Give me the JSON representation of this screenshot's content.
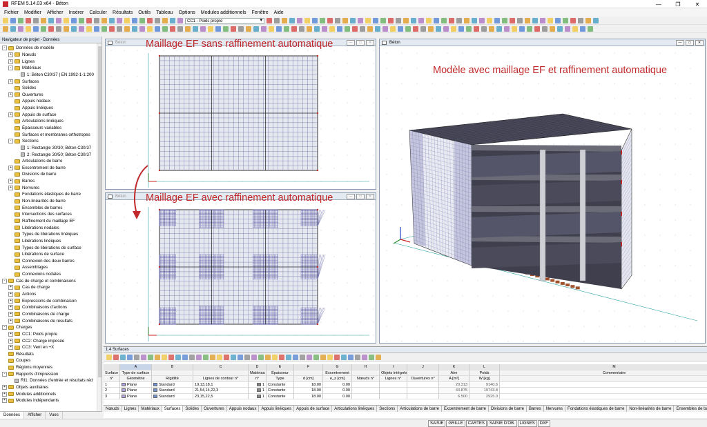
{
  "window": {
    "title": "RFEM 5.14.03 x64 - Béton",
    "min": "—",
    "max": "❐",
    "close": "✕"
  },
  "menu": [
    "Fichier",
    "Modifier",
    "Afficher",
    "Insérer",
    "Calculer",
    "Résultats",
    "Outils",
    "Tableau",
    "Options",
    "Modules additionnels",
    "Fenêtre",
    "Aide"
  ],
  "toolbar": {
    "loadcase": "CC1 - Poids propre"
  },
  "navigator": {
    "title": "Navigateur de projet - Données",
    "items": [
      {
        "label": "Données de modèle",
        "level": 0,
        "exp": "-",
        "icon": "fold"
      },
      {
        "label": "Nœuds",
        "level": 1,
        "exp": "+",
        "icon": "fold"
      },
      {
        "label": "Lignes",
        "level": 1,
        "exp": "+",
        "icon": "fold"
      },
      {
        "label": "Matériaux",
        "level": 1,
        "exp": "-",
        "icon": "fold"
      },
      {
        "label": "1: Béton C30/37 | EN 1992-1-1:200",
        "level": 2,
        "exp": "",
        "icon": "item"
      },
      {
        "label": "Surfaces",
        "level": 1,
        "exp": "+",
        "icon": "fold"
      },
      {
        "label": "Solides",
        "level": 1,
        "exp": "",
        "icon": "fold"
      },
      {
        "label": "Ouvertures",
        "level": 1,
        "exp": "+",
        "icon": "fold"
      },
      {
        "label": "Appuis nodaux",
        "level": 1,
        "exp": "",
        "icon": "fold"
      },
      {
        "label": "Appuis linéiques",
        "level": 1,
        "exp": "",
        "icon": "fold"
      },
      {
        "label": "Appuis de surface",
        "level": 1,
        "exp": "+",
        "icon": "fold"
      },
      {
        "label": "Articulations linéiques",
        "level": 1,
        "exp": "",
        "icon": "fold"
      },
      {
        "label": "Épaisseurs variables",
        "level": 1,
        "exp": "",
        "icon": "fold"
      },
      {
        "label": "Surfaces et membranes orthotropes",
        "level": 1,
        "exp": "",
        "icon": "fold"
      },
      {
        "label": "Sections",
        "level": 1,
        "exp": "-",
        "icon": "fold"
      },
      {
        "label": "1: Rectangle 30/30; Béton C30/37",
        "level": 2,
        "exp": "",
        "icon": "item"
      },
      {
        "label": "2: Rectangle 30/50; Béton C30/37",
        "level": 2,
        "exp": "",
        "icon": "item"
      },
      {
        "label": "Articulations de barre",
        "level": 1,
        "exp": "",
        "icon": "fold"
      },
      {
        "label": "Excentrement de barre",
        "level": 1,
        "exp": "+",
        "icon": "fold"
      },
      {
        "label": "Divisions de barre",
        "level": 1,
        "exp": "",
        "icon": "fold"
      },
      {
        "label": "Barres",
        "level": 1,
        "exp": "+",
        "icon": "fold"
      },
      {
        "label": "Nervures",
        "level": 1,
        "exp": "+",
        "icon": "fold"
      },
      {
        "label": "Fondations élastiques de barre",
        "level": 1,
        "exp": "",
        "icon": "fold"
      },
      {
        "label": "Non-linéarités de barre",
        "level": 1,
        "exp": "",
        "icon": "fold"
      },
      {
        "label": "Ensembles de barres",
        "level": 1,
        "exp": "",
        "icon": "fold"
      },
      {
        "label": "Intersections des surfaces",
        "level": 1,
        "exp": "",
        "icon": "fold"
      },
      {
        "label": "Raffinement du maillage EF",
        "level": 1,
        "exp": "",
        "icon": "fold"
      },
      {
        "label": "Libérations nodales",
        "level": 1,
        "exp": "",
        "icon": "fold"
      },
      {
        "label": "Types de libérations linéiques",
        "level": 1,
        "exp": "",
        "icon": "fold"
      },
      {
        "label": "Libérations linéiques",
        "level": 1,
        "exp": "",
        "icon": "fold"
      },
      {
        "label": "Types de libérations de surface",
        "level": 1,
        "exp": "",
        "icon": "fold"
      },
      {
        "label": "Libérations de surface",
        "level": 1,
        "exp": "",
        "icon": "fold"
      },
      {
        "label": "Connexion des deux barres",
        "level": 1,
        "exp": "",
        "icon": "fold"
      },
      {
        "label": "Assemblages",
        "level": 1,
        "exp": "",
        "icon": "fold"
      },
      {
        "label": "Connexions nodales",
        "level": 1,
        "exp": "",
        "icon": "fold"
      },
      {
        "label": "Cas de charge et combinaisons",
        "level": 0,
        "exp": "-",
        "icon": "fold"
      },
      {
        "label": "Cas de charge",
        "level": 1,
        "exp": "+",
        "icon": "fold"
      },
      {
        "label": "Actions",
        "level": 1,
        "exp": "+",
        "icon": "fold"
      },
      {
        "label": "Expressions de combinaison",
        "level": 1,
        "exp": "+",
        "icon": "fold"
      },
      {
        "label": "Combinaisons d'actions",
        "level": 1,
        "exp": "+",
        "icon": "fold"
      },
      {
        "label": "Combinaisons de charge",
        "level": 1,
        "exp": "+",
        "icon": "fold"
      },
      {
        "label": "Combinaisons de résultats",
        "level": 1,
        "exp": "+",
        "icon": "fold"
      },
      {
        "label": "Charges",
        "level": 0,
        "exp": "-",
        "icon": "fold"
      },
      {
        "label": "CC1: Poids propre",
        "level": 1,
        "exp": "+",
        "icon": "fold"
      },
      {
        "label": "CC2: Charge imposée",
        "level": 1,
        "exp": "+",
        "icon": "fold"
      },
      {
        "label": "CC3: Vent en +X",
        "level": 1,
        "exp": "+",
        "icon": "fold"
      },
      {
        "label": "Résultats",
        "level": 0,
        "exp": "",
        "icon": "fold"
      },
      {
        "label": "Coupes",
        "level": 0,
        "exp": "",
        "icon": "fold"
      },
      {
        "label": "Régions moyennes",
        "level": 0,
        "exp": "",
        "icon": "fold"
      },
      {
        "label": "Rapports d'impression",
        "level": 0,
        "exp": "-",
        "icon": "fold"
      },
      {
        "label": "RI1: Données d'entrée et résultats réd",
        "level": 1,
        "exp": "",
        "icon": "item"
      },
      {
        "label": "Objets auxiliaires",
        "level": 0,
        "exp": "+",
        "icon": "fold"
      },
      {
        "label": "Modules additionnels",
        "level": 0,
        "exp": "+",
        "icon": "fold"
      },
      {
        "label": "Modules indépendants",
        "level": 0,
        "exp": "+",
        "icon": "fold"
      }
    ],
    "tabs": [
      "Données",
      "Afficher",
      "Vues"
    ]
  },
  "views": {
    "v1": {
      "label": "Béton",
      "overlay": "Maillage EF sans raffinement automatique"
    },
    "v2": {
      "label": "Béton",
      "overlay": "Maillage EF avec raffinement automatique"
    },
    "v3": {
      "label": "Béton",
      "overlay": "Modèle avec maillage EF et raffinement automatique"
    },
    "ctrls": {
      "min": "—",
      "max": "▭",
      "close": "✕"
    }
  },
  "table": {
    "title": "1.4 Surfaces",
    "letters": [
      "",
      "A",
      "B",
      "C",
      "D",
      "E",
      "F",
      "G",
      "H",
      "I",
      "J",
      "K",
      "L",
      "M"
    ],
    "hdr1": [
      "Surface",
      "Type de surface",
      "",
      "",
      "Matériau",
      "Épaisseur",
      "",
      "Excentrement",
      "",
      "Objets intégrés",
      "",
      "Aire",
      "Poids",
      "Commentaire"
    ],
    "hdr2": [
      "n°",
      "Géométrie",
      "Rigidité",
      "Lignes de contour n°",
      "n°",
      "Type",
      "d [cm]",
      "e_z [cm]",
      "Nœuds n°",
      "Lignes n°",
      "Ouvertures n°",
      "A [m²]",
      "W [kg]",
      ""
    ],
    "rows": [
      [
        "1",
        "Plane",
        "Standard",
        "19,13,18,1",
        "1",
        "Constante",
        "18.00",
        "0.00",
        "",
        "",
        "",
        "20.313",
        "9140.6",
        ""
      ],
      [
        "2",
        "Plane",
        "Standard",
        "21,54,14,22,3",
        "1",
        "Constante",
        "18.00",
        "0.00",
        "",
        "",
        "",
        "43.875",
        "19743.8",
        ""
      ],
      [
        "3",
        "Plane",
        "Standard",
        "23,15,22,5",
        "1",
        "Constante",
        "18.00",
        "0.00",
        "",
        "",
        "",
        "6.500",
        "2925.0",
        ""
      ]
    ],
    "tabs": [
      "Nœuds",
      "Lignes",
      "Matériaux",
      "Surfaces",
      "Solides",
      "Ouvertures",
      "Appuis nodaux",
      "Appuis linéiques",
      "Appuis de surface",
      "Articulations linéiques",
      "Sections",
      "Articulations de barre",
      "Excentrement de barre",
      "Divisions de barre",
      "Barres",
      "Nervures",
      "Fondations élastiques de barre",
      "Non-linéarités de barre",
      "Ensembles de barres"
    ],
    "active_tab": "Surfaces"
  },
  "status": [
    "SAISIE",
    "GRILLE",
    "CARTES",
    "SAISIE D'OB.",
    "LIGNES",
    "DXF"
  ],
  "colors": {
    "accent": "#c0282a",
    "mesh": "#6e6ea8",
    "slab": "#4a4a5a"
  }
}
